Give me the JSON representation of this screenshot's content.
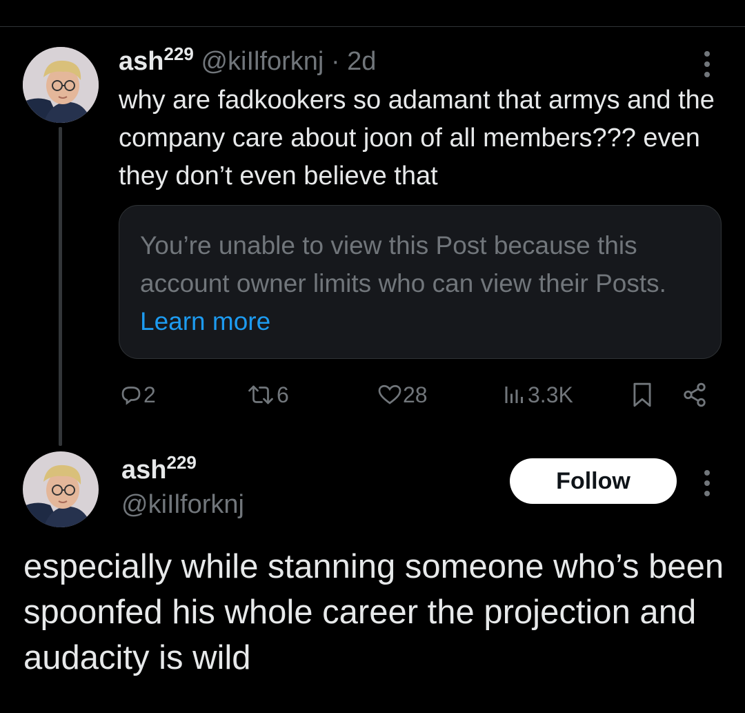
{
  "colors": {
    "background": "#000000",
    "text_primary": "#e7e9ea",
    "text_secondary": "#71767b",
    "link": "#1d9bf0",
    "card_background": "#16181c",
    "border": "#2f3336",
    "follow_button_bg": "#ffffff"
  },
  "parent_post": {
    "display_name": "ash",
    "display_name_sup": "229",
    "handle": "@kiIlforknj",
    "separator": "·",
    "time": "2d",
    "text": "why are fadkookers so adamant that armys and the company care about joon of all members??? even they don’t even believe that",
    "quoted_unavailable": {
      "message": "You’re unable to view this Post because this account owner limits who can view their Posts.",
      "link_text": "Learn more"
    },
    "actions": {
      "reply": {
        "icon": "reply-icon",
        "count": "2"
      },
      "repost": {
        "icon": "repost-icon",
        "count": "6"
      },
      "like": {
        "icon": "heart-icon",
        "count": "28"
      },
      "views": {
        "icon": "views-icon",
        "count": "3.3K"
      },
      "bookmark": {
        "icon": "bookmark-icon"
      },
      "share": {
        "icon": "share-icon"
      }
    },
    "more_icon": "more-vertical-icon"
  },
  "reply_post": {
    "display_name": "ash",
    "display_name_sup": "229",
    "handle": "@kiIlforknj",
    "follow_label": "Follow",
    "more_icon": "more-vertical-icon",
    "text": "especially while stanning someone who’s been spoonfed his whole career the projection and audacity is wild"
  }
}
